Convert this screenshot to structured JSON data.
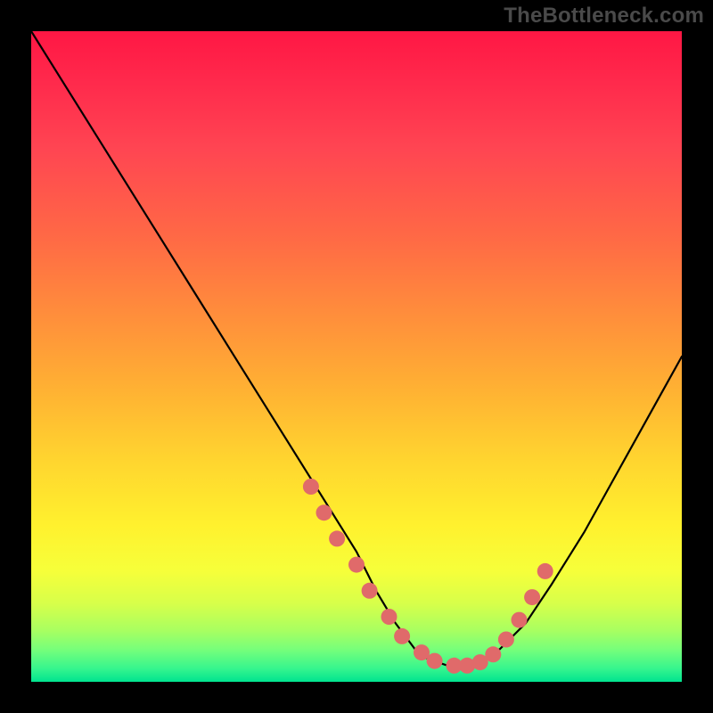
{
  "watermark": "TheBottleneck.com",
  "chart_data": {
    "type": "line",
    "title": "",
    "xlabel": "",
    "ylabel": "",
    "xlim": [
      0,
      100
    ],
    "ylim": [
      0,
      100
    ],
    "series": [
      {
        "name": "curve",
        "x": [
          0,
          5,
          10,
          15,
          20,
          25,
          30,
          35,
          40,
          45,
          50,
          53,
          56,
          59,
          61,
          64,
          66,
          69,
          72,
          76,
          80,
          85,
          90,
          95,
          100
        ],
        "y": [
          100,
          92,
          84,
          76,
          68,
          60,
          52,
          44,
          36,
          28,
          20,
          14,
          9,
          5,
          3.5,
          2.5,
          2.5,
          3.2,
          5,
          9,
          15,
          23,
          32,
          41,
          50
        ]
      }
    ],
    "markers": {
      "name": "highlight-dots",
      "color": "#e06a6a",
      "radius_px": 9,
      "x": [
        43,
        45,
        47,
        50,
        52,
        55,
        57,
        60,
        62,
        65,
        67,
        69,
        71,
        73,
        75,
        77,
        79
      ],
      "y": [
        30,
        26,
        22,
        18,
        14,
        10,
        7,
        4.5,
        3.2,
        2.5,
        2.5,
        3.0,
        4.2,
        6.5,
        9.5,
        13,
        17
      ]
    },
    "background_gradient": {
      "top": "#ff1744",
      "mid": "#ffd52f",
      "bottom": "#00e38f"
    }
  }
}
